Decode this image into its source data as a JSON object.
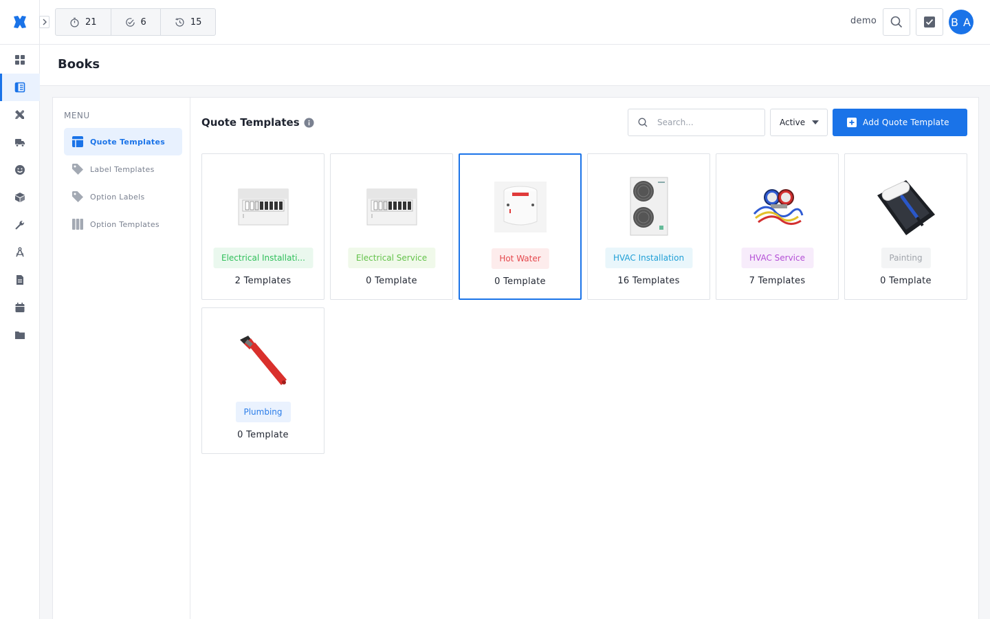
{
  "topbar": {
    "counters": [
      {
        "icon": "stopwatch-icon",
        "value": "21"
      },
      {
        "icon": "check-circle-icon",
        "value": "6"
      },
      {
        "icon": "clock-history-icon",
        "value": "15"
      }
    ],
    "user_name": "demo",
    "avatar_initials": "B A"
  },
  "sidebar": {
    "items": [
      {
        "icon": "dashboard-grid-icon"
      },
      {
        "icon": "book-icon",
        "active": true
      },
      {
        "icon": "tools-icon"
      },
      {
        "icon": "truck-icon"
      },
      {
        "icon": "smiley-icon"
      },
      {
        "icon": "box-icon"
      },
      {
        "icon": "wrench-icon"
      },
      {
        "icon": "compass-icon"
      },
      {
        "icon": "document-icon"
      },
      {
        "icon": "calendar-icon"
      },
      {
        "icon": "folder-icon"
      }
    ]
  },
  "page": {
    "title": "Books"
  },
  "submenu": {
    "heading": "MENU",
    "items": [
      {
        "label": "Quote Templates",
        "icon": "table-icon",
        "active": true
      },
      {
        "label": "Label Templates",
        "icon": "tag-icon"
      },
      {
        "label": "Option Labels",
        "icon": "tag-icon"
      },
      {
        "label": "Option Templates",
        "icon": "columns-icon"
      }
    ]
  },
  "main": {
    "title": "Quote Templates",
    "search_placeholder": "Search...",
    "status_value": "Active",
    "add_button_label": "Add Quote Template"
  },
  "colors": {
    "accent": "#1a73e8",
    "electrical_installation": "#2fbf5a",
    "electrical_service": "#63c24a",
    "hot_water": "#e5484d",
    "hvac_installation": "#1f9fd6",
    "hvac_service": "#b44fd6",
    "painting": "#a0a4ab",
    "plumbing": "#2b7de9"
  },
  "cards": [
    {
      "label": "Electrical Installati...",
      "count": "2 Templates",
      "image": "switchboard"
    },
    {
      "label": "Electrical Service",
      "count": "0 Template",
      "image": "switchboard"
    },
    {
      "label": "Hot Water",
      "count": "0 Template",
      "image": "water-heater",
      "selected": true
    },
    {
      "label": "HVAC Installation",
      "count": "16 Templates",
      "image": "hvac-unit"
    },
    {
      "label": "HVAC Service",
      "count": "7 Templates",
      "image": "manifold-gauge"
    },
    {
      "label": "Painting",
      "count": "0 Template",
      "image": "paint-roller"
    },
    {
      "label": "Plumbing",
      "count": "0 Template",
      "image": "pipe-wrench"
    }
  ]
}
